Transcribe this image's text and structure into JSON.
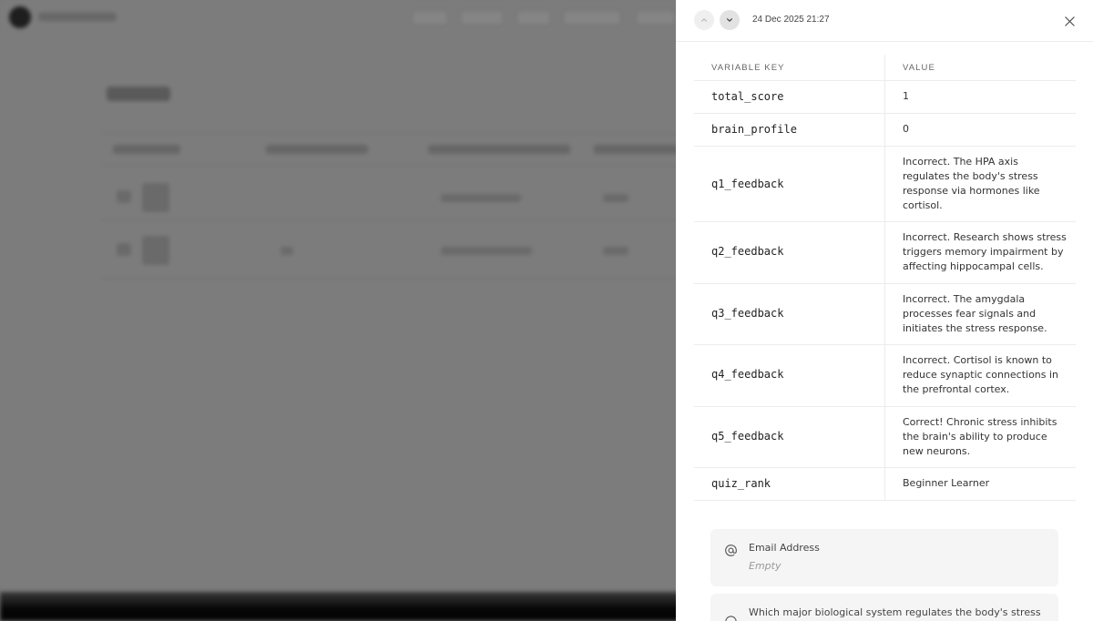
{
  "header": {
    "timestamp": "24 Dec 2025 21:27",
    "prev_icon": "chevron-up-icon",
    "next_icon": "chevron-down-icon",
    "close_icon": "close-icon"
  },
  "variables": {
    "key_header": "VARIABLE KEY",
    "value_header": "VALUE",
    "rows": [
      {
        "key": "total_score",
        "value": "1"
      },
      {
        "key": "brain_profile",
        "value": "0"
      },
      {
        "key": "q1_feedback",
        "value": "Incorrect. The HPA axis regulates the body's stress response via hormones like cortisol."
      },
      {
        "key": "q2_feedback",
        "value": "Incorrect. Research shows stress triggers memory impairment by affecting hippocampal cells."
      },
      {
        "key": "q3_feedback",
        "value": "Incorrect. The amygdala processes fear signals and initiates the stress response."
      },
      {
        "key": "q4_feedback",
        "value": "Incorrect. Cortisol is known to reduce synaptic connections in the prefrontal cortex."
      },
      {
        "key": "q5_feedback",
        "value": "Correct! Chronic stress inhibits the brain's ability to produce new neurons."
      },
      {
        "key": "quiz_rank",
        "value": "Beginner Learner"
      }
    ]
  },
  "fields": [
    {
      "icon": "at-sign-icon",
      "label": "Email Address",
      "value": "Empty"
    },
    {
      "icon": "circle-icon",
      "label": "Which major biological system regulates the body's stress",
      "value": ""
    }
  ]
}
